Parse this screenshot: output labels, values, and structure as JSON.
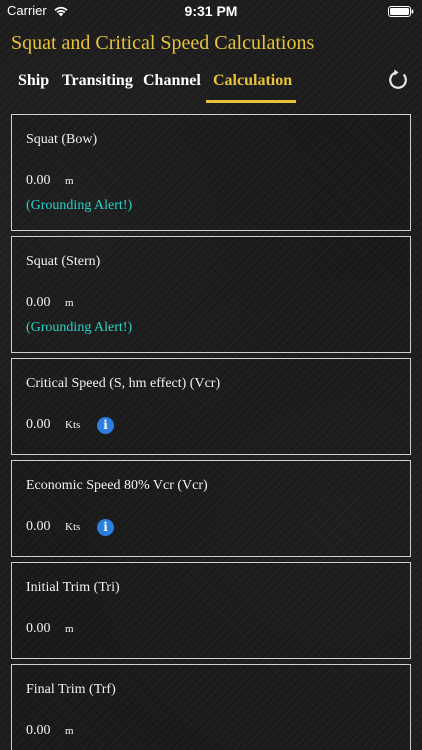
{
  "status_bar": {
    "carrier": "Carrier",
    "time": "9:31 PM"
  },
  "app": {
    "title": "Squat and Critical Speed Calculations"
  },
  "tabs": [
    {
      "label": "Ship",
      "active": false
    },
    {
      "label": "Transiting",
      "active": false
    },
    {
      "label": "Channel",
      "active": false
    },
    {
      "label": "Calculation",
      "active": true
    }
  ],
  "colors": {
    "accent": "#e8c23a",
    "alert": "#2ad3c8",
    "info": "#2b7de0",
    "border": "#cfcfcf"
  },
  "cards": [
    {
      "title": "Squat (Bow)",
      "value": "0.00",
      "unit": "m",
      "alert": "(Grounding Alert!)"
    },
    {
      "title": "Squat (Stern)",
      "value": "0.00",
      "unit": "m",
      "alert": "(Grounding Alert!)"
    },
    {
      "title": "Critical Speed (S, hm effect) (Vcr)",
      "value": "0.00",
      "unit": "Kts",
      "info_icon": "info-icon"
    },
    {
      "title": "Economic Speed 80% Vcr (Vcr)",
      "value": "0.00",
      "unit": "Kts",
      "info_icon": "info-icon"
    },
    {
      "title": "Initial Trim (Tri)",
      "value": "0.00",
      "unit": "m"
    },
    {
      "title": "Final Trim (Trf)",
      "value": "0.00",
      "unit": "m"
    }
  ],
  "info_glyph": "i"
}
